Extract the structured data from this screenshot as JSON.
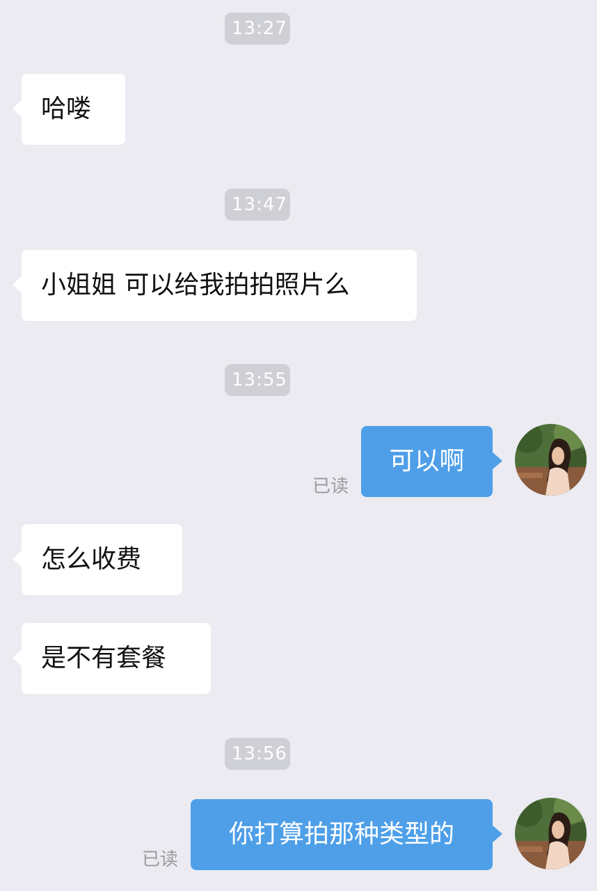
{
  "chat": {
    "timestamps": [
      "13:27",
      "13:47",
      "13:55",
      "13:56"
    ],
    "messages": [
      {
        "from": "contact",
        "text": "哈喽"
      },
      {
        "from": "contact",
        "text": "小姐姐 可以给我拍拍照片么"
      },
      {
        "from": "me",
        "text": "可以啊",
        "status": "已读"
      },
      {
        "from": "contact",
        "text": "怎么收费"
      },
      {
        "from": "contact",
        "text": "是不有套餐"
      },
      {
        "from": "me",
        "text": "你打算拍那种类型的",
        "status": "已读"
      }
    ]
  },
  "colors": {
    "background": "#ebebf1",
    "incoming_bubble": "#ffffff",
    "outgoing_bubble": "#4e9fe8",
    "timestamp_pill": "#cfcfd6",
    "read_status": "#9a9aa0"
  }
}
